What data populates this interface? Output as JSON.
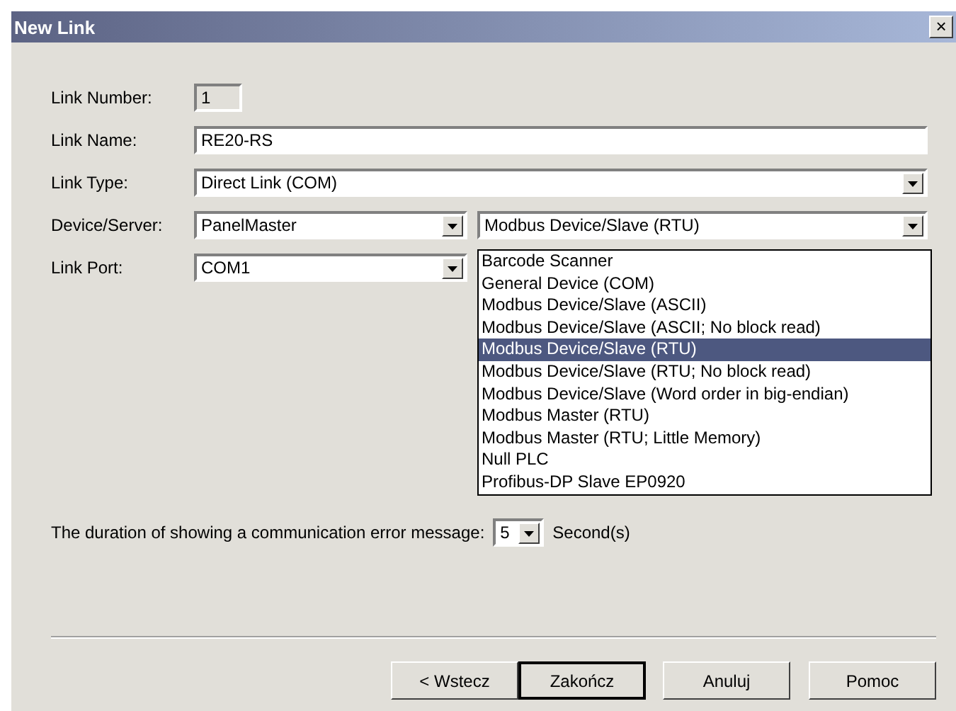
{
  "window": {
    "title": "New Link",
    "close": "×"
  },
  "fields": [
    {
      "kind": "readonly",
      "label": "Link Number:",
      "value": "1"
    },
    {
      "kind": "text",
      "label": "Link Name:",
      "value": "RE20-RS"
    },
    {
      "kind": "combo",
      "label": "Link Type:",
      "value": "Direct Link (COM)"
    },
    {
      "kind": "double",
      "label": "Device/Server:",
      "value": "PanelMaster",
      "value2": "Modbus Device/Slave (RTU)"
    },
    {
      "kind": "combo-short",
      "label": "Link Port:",
      "value": "COM1"
    }
  ],
  "dropdown": {
    "items": [
      {
        "label": "Barcode Scanner",
        "selected": false
      },
      {
        "label": "General Device (COM)",
        "selected": false
      },
      {
        "label": "Modbus Device/Slave (ASCII)",
        "selected": false
      },
      {
        "label": "Modbus Device/Slave (ASCII; No block read)",
        "selected": false
      },
      {
        "label": "Modbus Device/Slave (RTU)",
        "selected": true
      },
      {
        "label": "Modbus Device/Slave (RTU; No block read)",
        "selected": false
      },
      {
        "label": "Modbus Device/Slave (Word order in big-endian)",
        "selected": false
      },
      {
        "label": "Modbus Master (RTU)",
        "selected": false
      },
      {
        "label": "Modbus Master (RTU; Little Memory)",
        "selected": false
      },
      {
        "label": "Null PLC",
        "selected": false
      },
      {
        "label": "Profibus-DP Slave EP0920",
        "selected": false
      }
    ]
  },
  "duration": {
    "label": "The duration of showing a communication error message:",
    "value": "5",
    "unit": "Second(s)"
  },
  "buttons": [
    {
      "label": "< Wstecz",
      "default": false
    },
    {
      "label": "Zakończ",
      "default": true
    },
    {
      "label": "Anuluj",
      "default": false
    },
    {
      "label": "Pomoc",
      "default": false
    }
  ]
}
